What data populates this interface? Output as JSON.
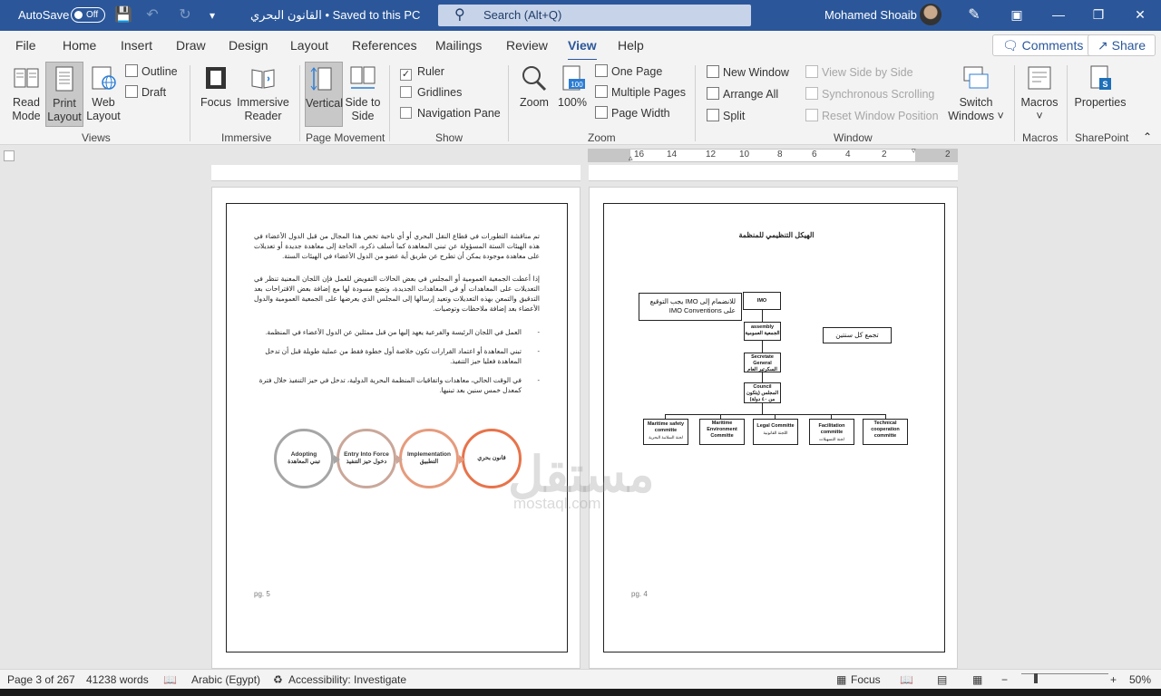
{
  "titlebar": {
    "autosave_label": "AutoSave",
    "autosave_state": "Off",
    "document_title": "القانون البحري • Saved to this PC",
    "search_placeholder": "Search (Alt+Q)",
    "user_name": "Mohamed Shoaib"
  },
  "menu": {
    "tabs": [
      "File",
      "Home",
      "Insert",
      "Draw",
      "Design",
      "Layout",
      "References",
      "Mailings",
      "Review",
      "View",
      "Help"
    ],
    "active_tab": "View",
    "comments_label": "Comments",
    "share_label": "Share"
  },
  "ribbon": {
    "views": {
      "read_mode": "Read Mode",
      "print_layout": "Print Layout",
      "web_layout": "Web Layout",
      "outline": "Outline",
      "draft": "Draft",
      "group": "Views"
    },
    "immersive": {
      "focus": "Focus",
      "immersive_reader": "Immersive Reader",
      "group": "Immersive"
    },
    "page_movement": {
      "vertical": "Vertical",
      "side_to_side": "Side to Side",
      "group": "Page Movement"
    },
    "show": {
      "ruler": "Ruler",
      "gridlines": "Gridlines",
      "navigation_pane": "Navigation Pane",
      "ruler_checked": true,
      "gridlines_checked": false,
      "navigation_checked": false,
      "group": "Show"
    },
    "zoom": {
      "zoom": "Zoom",
      "hundred": "100%",
      "one_page": "One Page",
      "multiple_pages": "Multiple Pages",
      "page_width": "Page Width",
      "group": "Zoom",
      "icon_text": "100"
    },
    "window": {
      "new_window": "New Window",
      "arrange_all": "Arrange All",
      "split": "Split",
      "view_side_by_side": "View Side by Side",
      "synchronous_scrolling": "Synchronous Scrolling",
      "reset_window_position": "Reset Window Position",
      "switch_windows": "Switch Windows",
      "group": "Window"
    },
    "macros": {
      "macros": "Macros",
      "group": "Macros"
    },
    "sharepoint": {
      "properties": "Properties",
      "group": "SharePoint"
    }
  },
  "ruler": {
    "ticks": [
      "16",
      "14",
      "12",
      "10",
      "8",
      "6",
      "4",
      "2",
      "2"
    ]
  },
  "page5": {
    "para1": "تم مناقشة التطورات في قطاع النقل البحري أو أي ناحية تخص هذا المجال من قبل الدول الأعضاء في هذه الهيئات الستة المسؤولة عن تبني المعاهدة كما أسلف ذكره، الحاجة إلى معاهدة جديدة أو تعديلات على معاهدة موجودة يمكن أن تطرح عن طريق أية عضو من الدول الأعضاء في الهيئات الستة.",
    "para2": "إذا أعطت الجمعية العمومية أو المجلس في بعض الحالات التفويض للعمل فإن اللجان المعنية تنظر في التعديلات على المعاهدات أو في المعاهدات الجديدة، وتضع مسودة لها مع إضافة بعض الاقتراحات بعد التدقيق والتمعن بهذه التعديلات وتعيد إرسالها إلى المجلس الذي يعرضها على الجمعية العمومية والدول الأعضاء بعد إضافة ملاحظات وتوصيات.",
    "bullets": [
      "العمل في اللجان الرئيسة والفرعية يعهد إليها من قبل ممثلين عن الدول الأعضاء في المنظمة.",
      "تبني المعاهدة أو اعتماد القرارات تكون خلاصة أول خطوة فقط من عملية طويلة قبل أن تدخل المعاهدة فعليا حيز التنفيذ.",
      "في الوقت الحالي، معاهدات واتفاقيات المنظمة البحرية الدولية، تدخل في حيز التنفيذ خلال فترة كمعدل خمس سنين بعد تبنيها."
    ],
    "bullet_marker": "-",
    "process": [
      {
        "en": "Adopting",
        "ar": "تبني المعاهدة",
        "color": "#a6a6a6"
      },
      {
        "en": "Entry Into Force",
        "ar": "دخول حيز التنفيذ",
        "color": "#c9a79a"
      },
      {
        "en": "Implementation",
        "ar": "التطبيق",
        "color": "#e69b7d"
      },
      {
        "en": "",
        "ar": "قانون بحري",
        "color": "#e8734a"
      }
    ],
    "page_number": "pg. 5"
  },
  "page4": {
    "title": "الهيكل التنظيمي للمنظمة",
    "note_left": "للانضمام إلى IMO يجب التوقيع على IMO Conventions",
    "note_right": "تجمع كل سنتين",
    "org": {
      "imo": "IMO",
      "assembly": "assembly الجمعية العمومية",
      "secretariat": "Secretate General السكرتير العام",
      "council": "Council المجلس (يتكون من ٤٠ دولة)",
      "committees": [
        {
          "name": "Maritime safety committe",
          "ar": "لجنة السلامة البحرية"
        },
        {
          "name": "Maritime Environment Committe",
          "ar": "لجنة البيئة"
        },
        {
          "name": "Legal Committe",
          "ar": "اللجنة القانونية"
        },
        {
          "name": "Facilitation committe",
          "ar": "لجنة التسهيلات"
        },
        {
          "name": "Technical cooperation committe",
          "ar": "لجنة التعاون الفني"
        }
      ]
    },
    "page_number": "pg. 4"
  },
  "watermark": {
    "ar": "مستقل",
    "en": "mostaql.com"
  },
  "status": {
    "page": "Page 3 of 267",
    "words": "41238 words",
    "language": "Arabic (Egypt)",
    "accessibility": "Accessibility: Investigate",
    "focus": "Focus",
    "zoom": "50%",
    "zoom_minus": "−",
    "zoom_plus": "+"
  }
}
